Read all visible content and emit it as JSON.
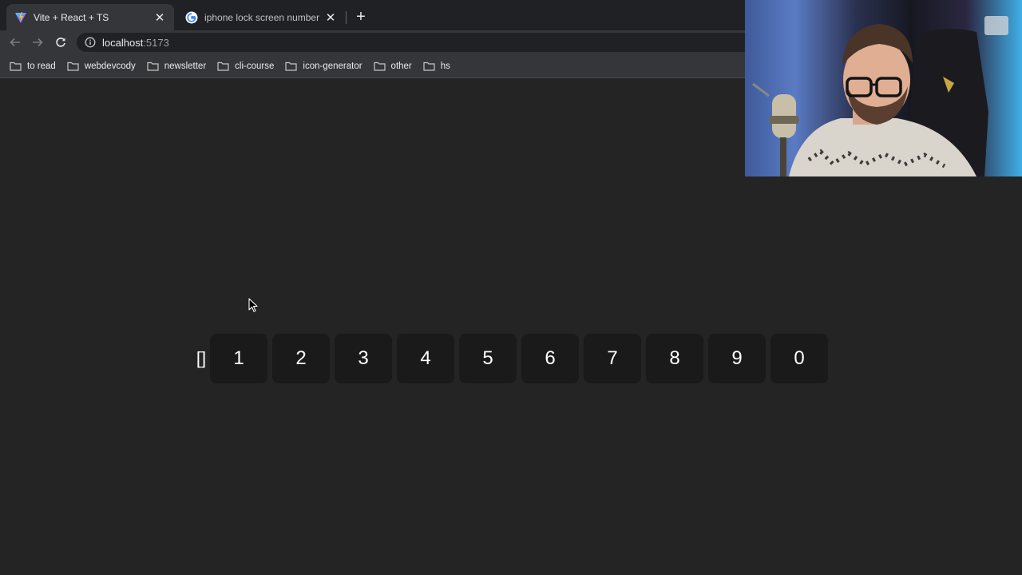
{
  "browser": {
    "tabs": [
      {
        "title": "Vite + React + TS",
        "active": true,
        "icon": "vite-logo-icon"
      },
      {
        "title": "iphone lock screen number pa",
        "active": false,
        "icon": "google-logo-icon"
      }
    ],
    "address": {
      "host": "localhost",
      "port": ":5173"
    },
    "bookmarks": [
      {
        "label": "to read"
      },
      {
        "label": "webdevcody"
      },
      {
        "label": "newsletter"
      },
      {
        "label": "cli-course"
      },
      {
        "label": "icon-generator"
      },
      {
        "label": "other"
      },
      {
        "label": "hs"
      }
    ]
  },
  "app": {
    "code_display": "[]",
    "digits": [
      "1",
      "2",
      "3",
      "4",
      "5",
      "6",
      "7",
      "8",
      "9",
      "0"
    ]
  },
  "colors": {
    "page_bg": "#242424",
    "digit_bg": "#1a1a1a",
    "chrome_toolbar": "#35363a",
    "chrome_tabstrip": "#202124"
  }
}
